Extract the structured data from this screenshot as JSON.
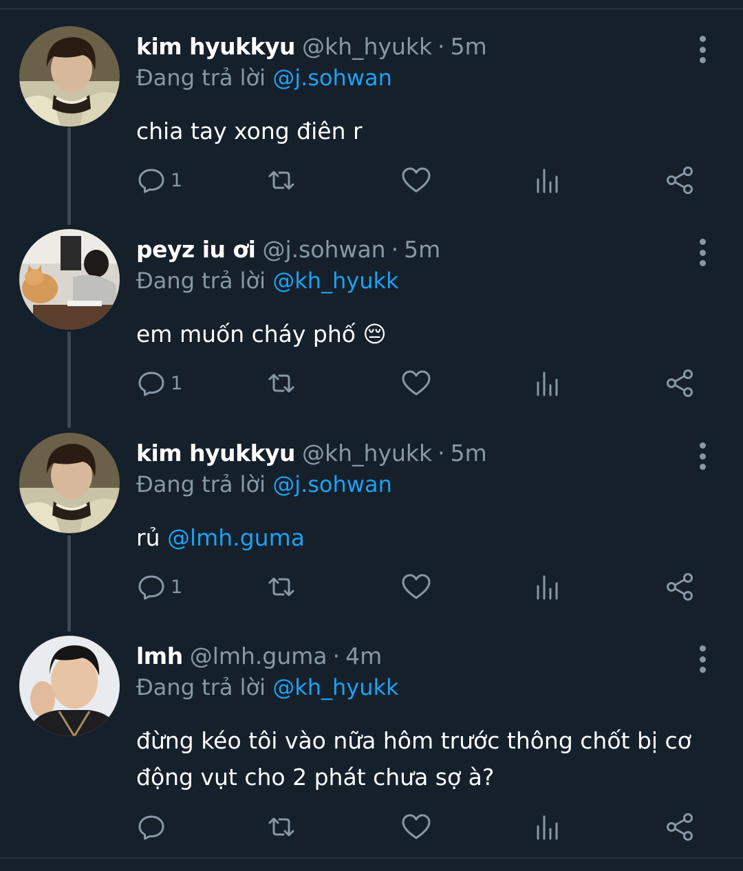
{
  "thread": {
    "tweets": [
      {
        "name": "kim hyukkyu",
        "handle": "@kh_hyukk",
        "separator": "·",
        "time": "5m",
        "reply_prefix": "Đang trả lời ",
        "reply_to": "@j.sohwan",
        "text": "chia tay xong điên r",
        "text_mention": "",
        "reply_count": "1"
      },
      {
        "name": "peyz iu ơi",
        "handle": "@j.sohwan",
        "separator": "·",
        "time": "5m",
        "reply_prefix": "Đang trả lời ",
        "reply_to": "@kh_hyukk",
        "text": "em muốn cháy phố 😔",
        "text_mention": "",
        "reply_count": "1"
      },
      {
        "name": "kim hyukkyu",
        "handle": "@kh_hyukk",
        "separator": "·",
        "time": "5m",
        "reply_prefix": "Đang trả lời ",
        "reply_to": "@j.sohwan",
        "text": "rủ ",
        "text_mention": "@lmh.guma",
        "reply_count": "1"
      },
      {
        "name": "lmh",
        "handle": "@lmh.guma",
        "separator": "·",
        "time": "4m",
        "reply_prefix": "Đang trả lời ",
        "reply_to": "@kh_hyukk",
        "text": "đừng kéo tôi vào nữa hôm trước thông chốt bị cơ động vụt cho 2 phát chưa sợ à?",
        "text_mention": "",
        "reply_count": ""
      }
    ]
  },
  "icons": {
    "reply": "reply-bubble-icon",
    "retweet": "retweet-icon",
    "like": "heart-icon",
    "views": "bar-chart-icon",
    "share": "share-icon",
    "more": "vertical-dots-icon"
  },
  "colors": {
    "background": "#15202b",
    "muted": "#8899a6",
    "mention": "#1da1f2",
    "thread_line": "#3d4853"
  }
}
